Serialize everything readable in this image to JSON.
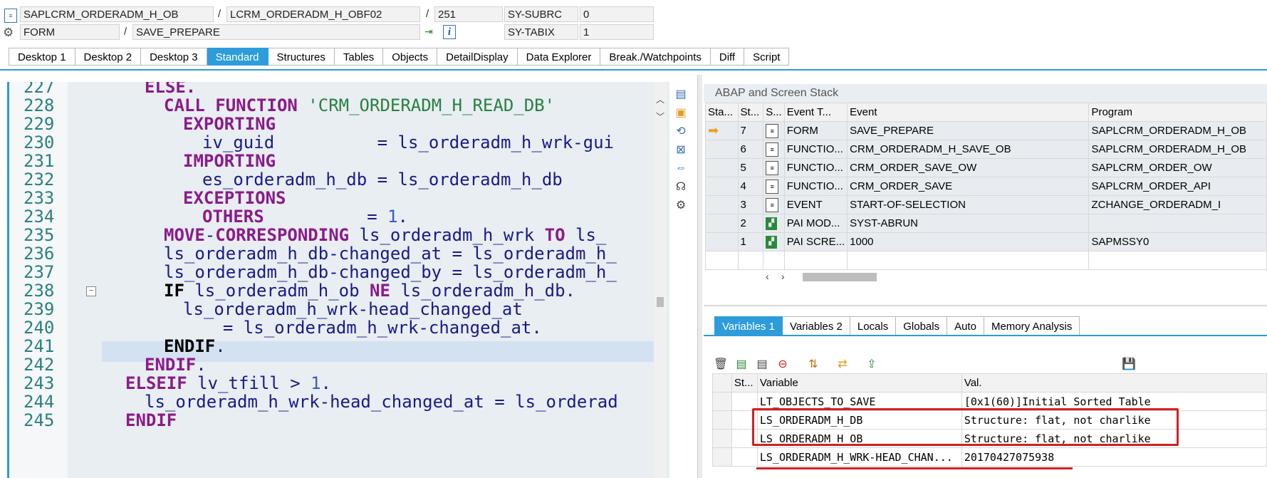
{
  "header": {
    "program": "SAPLCRM_ORDERADM_H_OB",
    "include": "LCRM_ORDERADM_H_OBF02",
    "line_no": "251",
    "sy_subrc_label": "SY-SUBRC",
    "sy_subrc_value": "0",
    "event_type": "FORM",
    "event_name": "SAVE_PREPARE",
    "sy_tabix_label": "SY-TABIX",
    "sy_tabix_value": "1",
    "slash": "/"
  },
  "tabs": [
    "Desktop 1",
    "Desktop 2",
    "Desktop 3",
    "Standard",
    "Structures",
    "Tables",
    "Objects",
    "DetailDisplay",
    "Data Explorer",
    "Break./Watchpoints",
    "Diff",
    "Script"
  ],
  "active_tab": "Standard",
  "code_lines": [
    {
      "no": "227"
    },
    {
      "no": "228"
    },
    {
      "no": "229"
    },
    {
      "no": "230"
    },
    {
      "no": "231"
    },
    {
      "no": "232"
    },
    {
      "no": "233"
    },
    {
      "no": "234"
    },
    {
      "no": "235"
    },
    {
      "no": "236"
    },
    {
      "no": "237"
    },
    {
      "no": "238"
    },
    {
      "no": "239"
    },
    {
      "no": "240"
    },
    {
      "no": "241"
    },
    {
      "no": "242"
    },
    {
      "no": "243"
    },
    {
      "no": "244"
    },
    {
      "no": "245"
    }
  ],
  "code": {
    "l227_kw": "ELSE.",
    "l228_kw": "CALL FUNCTION",
    "l228_str": "'CRM_ORDERADM_H_READ_DB'",
    "l229_kw": "EXPORTING",
    "l230": "iv_guid          = ls_orderadm_h_wrk-gui",
    "l231_kw": "IMPORTING",
    "l232": "es_orderadm_h_db = ls_orderadm_h_db",
    "l233_kw": "EXCEPTIONS",
    "l234_kw": "OTHERS",
    "l234_rest": "          = ",
    "l234_num": "1",
    "l234_end": ".",
    "l235_kw1": "MOVE",
    "l235_mid": "-",
    "l235_kw2": "CORRESPONDING",
    "l235_var": " ls_orderadm_h_wrk ",
    "l235_kw3": "TO",
    "l235_end": " ls_",
    "l236": "ls_orderadm_h_db-changed_at = ls_orderadm_h_",
    "l237": "ls_orderadm_h_db-changed_by = ls_orderadm_h_",
    "l238_kw1": "IF",
    "l238_mid": " ls_orderadm_h_ob ",
    "l238_kw2": "NE",
    "l238_end": " ls_orderadm_h_db.",
    "l239": "ls_orderadm_h_wrk-head_changed_at",
    "l240": "  = ls_orderadm_h_wrk-changed_at.",
    "l241_kw": "ENDIF",
    "l241_end": ".",
    "l242_kw": "ENDIF",
    "l242_end": ".",
    "l243_kw": "ELSEIF",
    "l243_mid": " lv_tfill > ",
    "l243_num": "1",
    "l243_end": ".",
    "l244": "ls_orderadm_h_wrk-head_changed_at = ls_orderad",
    "l245_kw": "ENDIF"
  },
  "stack": {
    "title": "ABAP and Screen Stack",
    "columns": [
      "Sta...",
      "St...",
      "S...",
      "Event T...",
      "Event",
      "Program"
    ],
    "rows": [
      {
        "level": "7",
        "type": "FORM",
        "event": "SAVE_PREPARE",
        "program": "SAPLCRM_ORDERADM_H_OB",
        "current": true,
        "icon": "document-icon"
      },
      {
        "level": "6",
        "type": "FUNCTIO...",
        "event": "CRM_ORDERADM_H_SAVE_OB",
        "program": "SAPLCRM_ORDERADM_H_OB",
        "icon": "document-icon"
      },
      {
        "level": "5",
        "type": "FUNCTIO...",
        "event": "CRM_ORDER_SAVE_OW",
        "program": "SAPLCRM_ORDER_OW",
        "icon": "document-icon"
      },
      {
        "level": "4",
        "type": "FUNCTIO...",
        "event": "CRM_ORDER_SAVE",
        "program": "SAPLCRM_ORDER_API",
        "icon": "document-icon"
      },
      {
        "level": "3",
        "type": "EVENT",
        "event": "START-OF-SELECTION",
        "program": "ZCHANGE_ORDERADM_I",
        "icon": "document-icon"
      },
      {
        "level": "2",
        "type": "PAI MOD...",
        "event": "SYST-ABRUN",
        "program": "",
        "icon": "screen-icon"
      },
      {
        "level": "1",
        "type": "PAI SCRE...",
        "event": "1000",
        "program": "SAPMSSY0",
        "icon": "screen-icon"
      }
    ]
  },
  "var_tabs": [
    "Variables 1",
    "Variables 2",
    "Locals",
    "Globals",
    "Auto",
    "Memory Analysis"
  ],
  "active_var_tab": "Variables 1",
  "variables": {
    "columns": [
      "St...",
      "Variable",
      "Val."
    ],
    "rows": [
      {
        "name": "LT_OBJECTS_TO_SAVE",
        "value": "[0x1(60)]Initial Sorted Table"
      },
      {
        "name": "LS_ORDERADM_H_DB",
        "value": "Structure: flat, not charlike"
      },
      {
        "name": "LS_ORDERADM_H_OB",
        "value": "Structure: flat, not charlike"
      },
      {
        "name": "LS_ORDERADM_H_WRK-HEAD_CHAN...",
        "value": "20170427075938"
      }
    ]
  },
  "colors": {
    "accent": "#2d9cdb",
    "highlight": "#d42020",
    "keyword": "#8b1a8b",
    "string": "#2a8040"
  }
}
